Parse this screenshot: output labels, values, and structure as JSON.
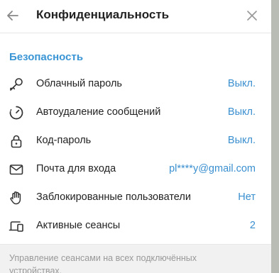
{
  "header": {
    "title": "Конфиденциальность",
    "back_icon": "arrow-left-icon",
    "close_icon": "close-icon"
  },
  "section": {
    "title": "Безопасность"
  },
  "items": [
    {
      "icon": "key-icon",
      "label": "Облачный пароль",
      "value": "Выкл."
    },
    {
      "icon": "timer-icon",
      "label": "Автоудаление сообщений",
      "value": "Выкл."
    },
    {
      "icon": "lock-icon",
      "label": "Код-пароль",
      "value": "Выкл."
    },
    {
      "icon": "mail-icon",
      "label": "Почта для входа",
      "value": "pl****y@gmail.com"
    },
    {
      "icon": "hand-icon",
      "label": "Заблокированные пользователи",
      "value": "Нет"
    },
    {
      "icon": "devices-icon",
      "label": "Активные сеансы",
      "value": "2"
    }
  ],
  "footer": {
    "text": "Управление сеансами на всех подключённых устройствах."
  },
  "colors": {
    "accent": "#3a95d5",
    "text": "#222222",
    "muted": "#999999"
  }
}
